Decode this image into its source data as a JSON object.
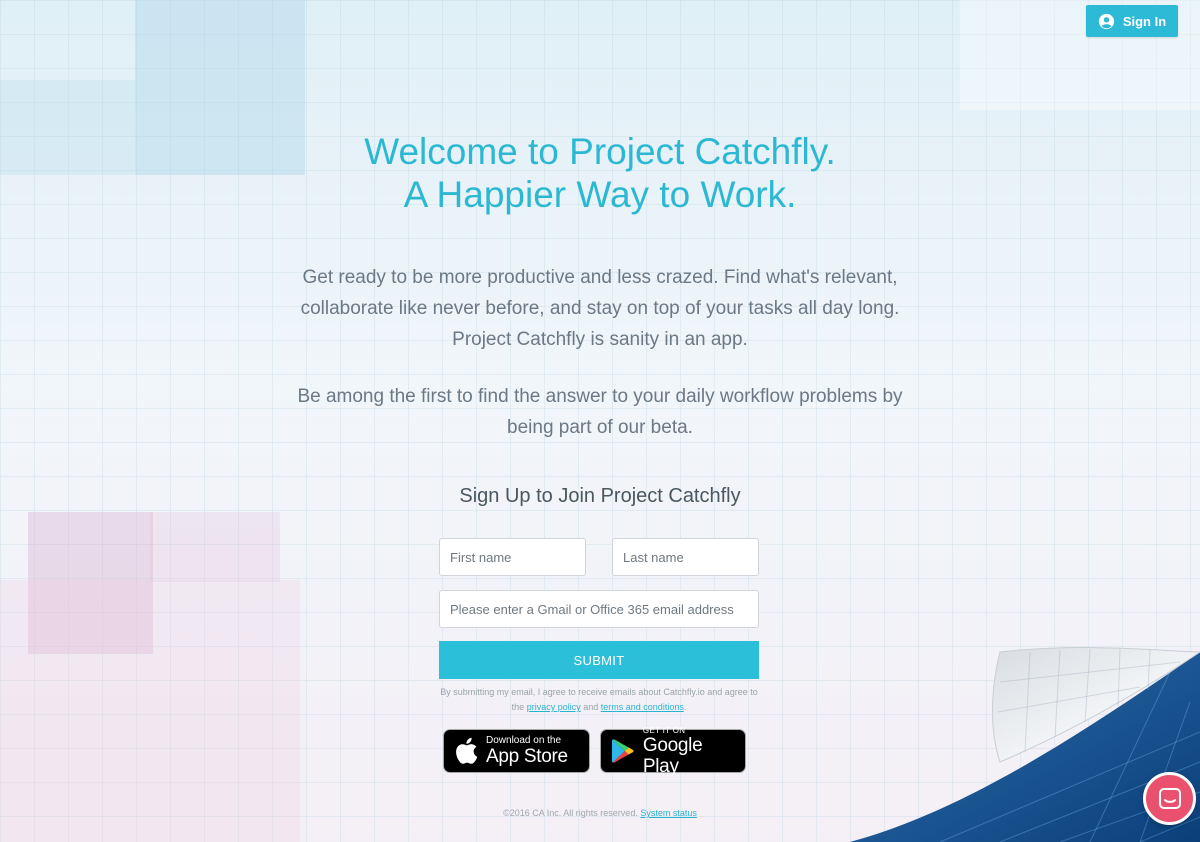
{
  "header": {
    "signin_label": "Sign In"
  },
  "hero": {
    "title_line1": "Welcome to Project Catchfly.",
    "title_line2": "A Happier Way to Work.",
    "intro_line1": "Get ready to be more productive and less crazed. Find what's relevant,",
    "intro_line2": "collaborate like never before, and stay on top of your tasks all day long.",
    "intro_line3": "Project Catchfly is sanity in an app.",
    "beta_line1": "Be among the first to find the answer to your daily workflow problems by",
    "beta_line2": "being part of our beta."
  },
  "form": {
    "title": "Sign Up to Join Project Catchfly",
    "first_name_placeholder": "First name",
    "last_name_placeholder": "Last name",
    "email_placeholder": "Please enter a Gmail or Office 365 email address",
    "submit_label": "SUBMIT",
    "terms_prefix": "By submitting my email, I agree to receive emails about Catchfly.io and agree to the",
    "privacy_link": "privacy policy",
    "terms_and": "and",
    "terms_link": "terms and conditions",
    "terms_suffix": "."
  },
  "badges": {
    "apple_small": "Download on the",
    "apple_big": "App Store",
    "google_small": "GET IT ON",
    "google_big": "Google Play"
  },
  "footer": {
    "copyright": "©2016 CA Inc. All rights reserved.",
    "status_link": "System status"
  },
  "colors": {
    "accent": "#2cbad6",
    "chat": "#e9516e"
  }
}
